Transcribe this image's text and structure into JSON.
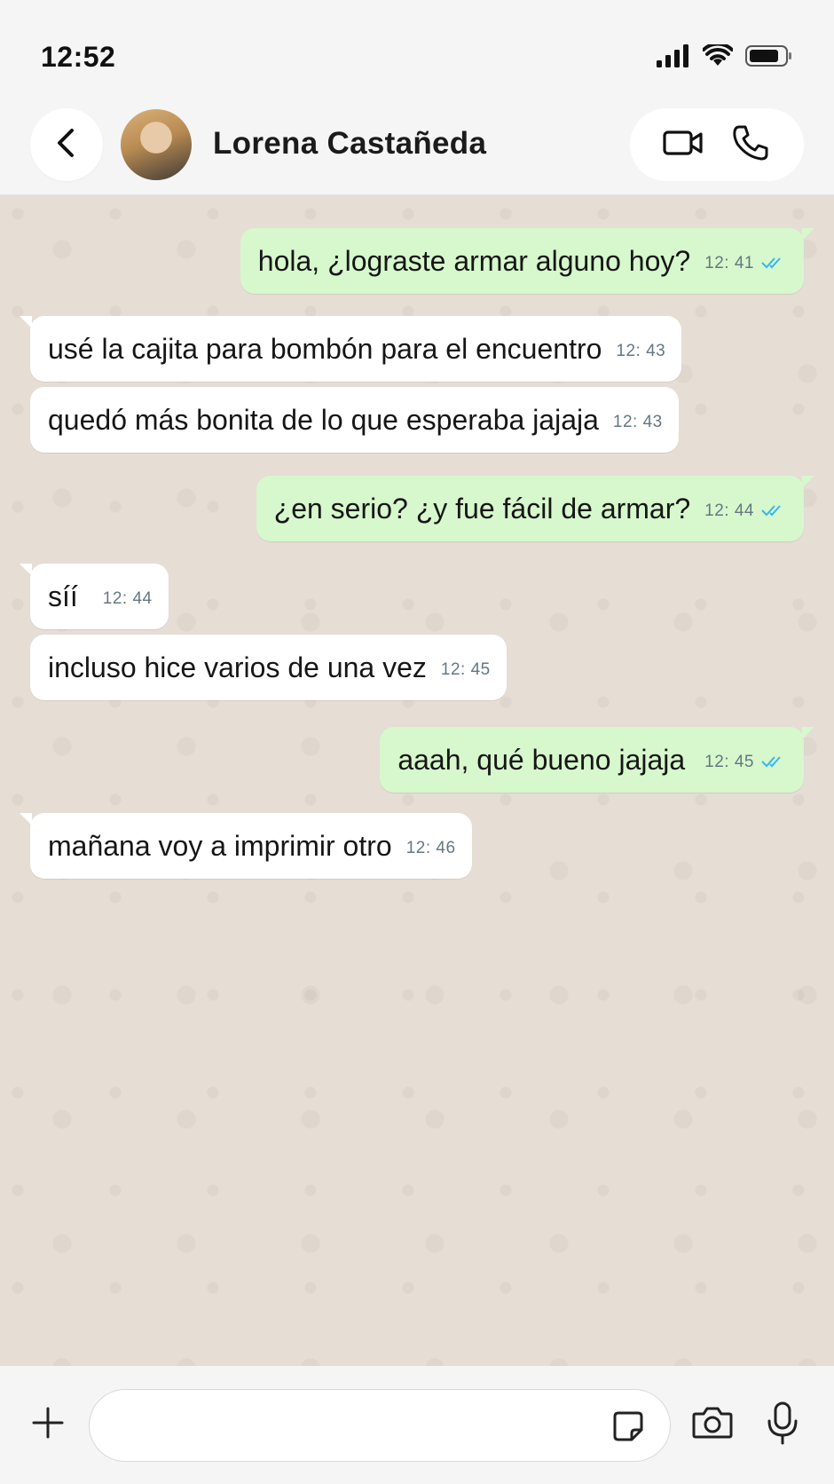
{
  "status_bar": {
    "time": "12:52",
    "icons": [
      "cellular-signal-icon",
      "wifi-icon",
      "battery-icon"
    ]
  },
  "header": {
    "contact_name": "Lorena Castañeda",
    "icons": [
      "back-chevron-icon",
      "video-call-icon",
      "phone-call-icon"
    ]
  },
  "messages": [
    {
      "direction": "outgoing",
      "text": "hola, ¿lograste armar alguno hoy?",
      "time": "12: 41",
      "read": true
    },
    {
      "direction": "incoming",
      "text": "usé la cajita para bombón para el encuentro",
      "time": "12: 43"
    },
    {
      "direction": "incoming",
      "text": "quedó más bonita de lo que esperaba jajaja",
      "time": "12: 43"
    },
    {
      "direction": "outgoing",
      "text": "¿en serio? ¿y fue fácil de armar?",
      "time": "12: 44",
      "read": true
    },
    {
      "direction": "incoming",
      "text": "síí",
      "time": "12: 44"
    },
    {
      "direction": "incoming",
      "text": "incluso hice varios de una vez",
      "time": "12: 45"
    },
    {
      "direction": "outgoing",
      "text": "aaah, qué bueno jajaja",
      "time": "12: 45",
      "read": true
    },
    {
      "direction": "incoming",
      "text": "mañana voy a imprimir otro",
      "time": "12: 46"
    }
  ],
  "input_bar": {
    "placeholder": "",
    "value": "",
    "icons": [
      "plus-icon",
      "sticker-icon",
      "camera-icon",
      "microphone-icon"
    ]
  },
  "colors": {
    "chat_background": "#e6ddd4",
    "outgoing_bubble": "#d6f8cc",
    "incoming_bubble": "#ffffff",
    "read_ticks": "#34b7f1",
    "timestamp": "#667781"
  }
}
